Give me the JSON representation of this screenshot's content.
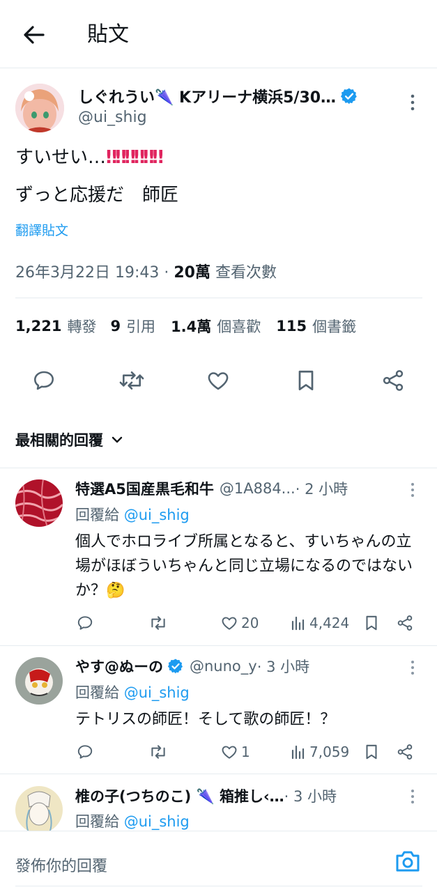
{
  "header": {
    "title": "貼文"
  },
  "tweet": {
    "display_name": "しぐれうい🌂 Kアリーナ横浜5/30…",
    "handle": "@ui_shig",
    "line1": "すいせい…",
    "line1_emoji": "‼‼‼‼‼‼",
    "line2": "ずっと応援だ　師匠",
    "translate": "翻譯貼文",
    "timestamp": "26年3月22日 19:43 · ",
    "views_count": "20萬",
    "views_label": " 查看次數"
  },
  "stats": {
    "retweets_count": "1,221",
    "retweets_label": "轉發",
    "quotes_count": "9",
    "quotes_label": "引用",
    "likes_count": "1.4萬",
    "likes_label": "個喜歡",
    "bookmarks_count": "115",
    "bookmarks_label": "個書籤"
  },
  "sort": {
    "label": "最相關的回覆"
  },
  "replies": [
    {
      "name": "特選A5国産黒毛和牛",
      "handle": "@1A884...",
      "time": " · 2 小時",
      "reply_to_prefix": "回覆給 ",
      "reply_to": "@ui_shig",
      "text": "個人でホロライブ所属となると、すいちゃんの立場がほぼういちゃんと同じ立場になるのではないか？🤔",
      "likes": "20",
      "views": "4,424"
    },
    {
      "name": "やす@ぬーの",
      "handle": "@nuno_y",
      "time": " · 3 小時",
      "reply_to_prefix": "回覆給 ",
      "reply_to": "@ui_shig",
      "text": "テトリスの師匠！そして歌の師匠！？",
      "likes": "1",
      "views": "7,059"
    },
    {
      "name": "椎の子(つちのこ) 🌂 箱推し‹…",
      "handle": "",
      "time": " · 3 小時",
      "reply_to_prefix": "回覆給 ",
      "reply_to": "@ui_shig"
    }
  ],
  "composer": {
    "placeholder": "發佈你的回覆"
  },
  "colors": {
    "accent": "#1d9bf0",
    "text": "#0f1419",
    "muted": "#536471",
    "divider": "#e6ecf0"
  },
  "icons": [
    "back-arrow-icon",
    "verified-icon",
    "more-icon",
    "reply-icon",
    "retweet-icon",
    "like-icon",
    "bookmark-icon",
    "share-icon",
    "views-icon",
    "chevron-down-icon",
    "camera-icon"
  ]
}
